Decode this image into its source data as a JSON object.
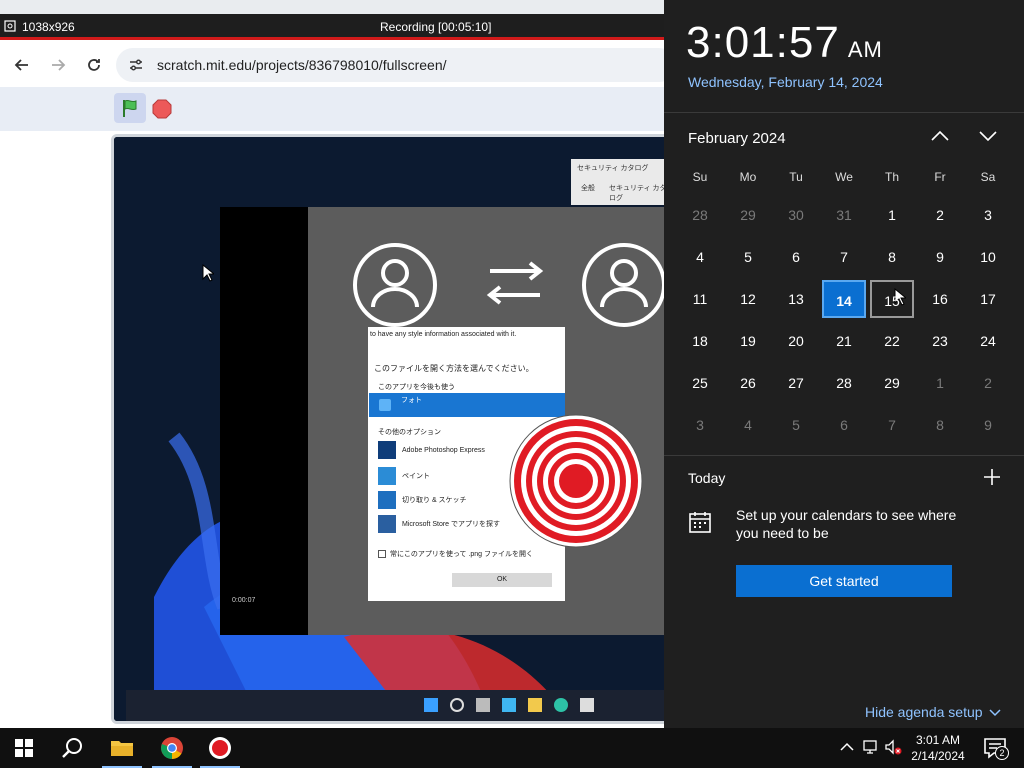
{
  "recorder": {
    "resolution": "1038x926",
    "title": "Recording [00:05:10]"
  },
  "browser": {
    "url": "scratch.mit.edu/projects/836798010/fullscreen/"
  },
  "stage": {
    "dialog": {
      "header": "to have any style information associated with it.",
      "question": "このファイルを開く方法を選んでください。",
      "keep_using": "このアプリを今後も使う",
      "selected_app": "フォト",
      "other_options": "その他のオプション",
      "apps": [
        "Adobe Photoshop Express",
        "ペイント",
        "切り取り & スケッチ",
        "Microsoft Store でアプリを探す"
      ],
      "checkbox": "常にこのアプリを使って .png ファイルを開く",
      "ok": "OK"
    },
    "security_window": {
      "title": "セキュリティ カタログ",
      "tabs": [
        "全般",
        "セキュリティ カタログ"
      ]
    },
    "time_label": "0:00:07"
  },
  "clock": {
    "time": "3:01:57",
    "ampm": "AM",
    "date_long": "Wednesday, February 14, 2024"
  },
  "calendar": {
    "month_label": "February 2024",
    "weekdays": [
      "Su",
      "Mo",
      "Tu",
      "We",
      "Th",
      "Fr",
      "Sa"
    ],
    "weeks": [
      [
        {
          "d": "28",
          "m": true
        },
        {
          "d": "29",
          "m": true
        },
        {
          "d": "30",
          "m": true
        },
        {
          "d": "31",
          "m": true
        },
        {
          "d": "1"
        },
        {
          "d": "2"
        },
        {
          "d": "3"
        }
      ],
      [
        {
          "d": "4"
        },
        {
          "d": "5"
        },
        {
          "d": "6"
        },
        {
          "d": "7"
        },
        {
          "d": "8"
        },
        {
          "d": "9"
        },
        {
          "d": "10"
        }
      ],
      [
        {
          "d": "11"
        },
        {
          "d": "12"
        },
        {
          "d": "13"
        },
        {
          "d": "14",
          "today": true
        },
        {
          "d": "15",
          "hover": true
        },
        {
          "d": "16"
        },
        {
          "d": "17"
        }
      ],
      [
        {
          "d": "18"
        },
        {
          "d": "19"
        },
        {
          "d": "20"
        },
        {
          "d": "21"
        },
        {
          "d": "22"
        },
        {
          "d": "23"
        },
        {
          "d": "24"
        }
      ],
      [
        {
          "d": "25"
        },
        {
          "d": "26"
        },
        {
          "d": "27"
        },
        {
          "d": "28"
        },
        {
          "d": "29"
        },
        {
          "d": "1",
          "m": true
        },
        {
          "d": "2",
          "m": true
        }
      ],
      [
        {
          "d": "3",
          "m": true
        },
        {
          "d": "4",
          "m": true
        },
        {
          "d": "5",
          "m": true
        },
        {
          "d": "6",
          "m": true
        },
        {
          "d": "7",
          "m": true
        },
        {
          "d": "8",
          "m": true
        },
        {
          "d": "9",
          "m": true
        }
      ]
    ]
  },
  "agenda": {
    "today_label": "Today",
    "setup_text": "Set up your calendars to see where you need to be",
    "get_started": "Get started",
    "hide_agenda": "Hide agenda setup"
  },
  "taskbar": {
    "time": "3:01 AM",
    "date": "2/14/2024",
    "notification_count": "2",
    "apps": [
      "start-icon",
      "search-icon",
      "file-explorer-icon",
      "chrome-icon",
      "recorder-icon"
    ]
  },
  "colors": {
    "accent": "#0a6fd1",
    "flyout_bg": "#1f1f1f",
    "link": "#8fc3ff",
    "record_red": "#d11a1a"
  }
}
